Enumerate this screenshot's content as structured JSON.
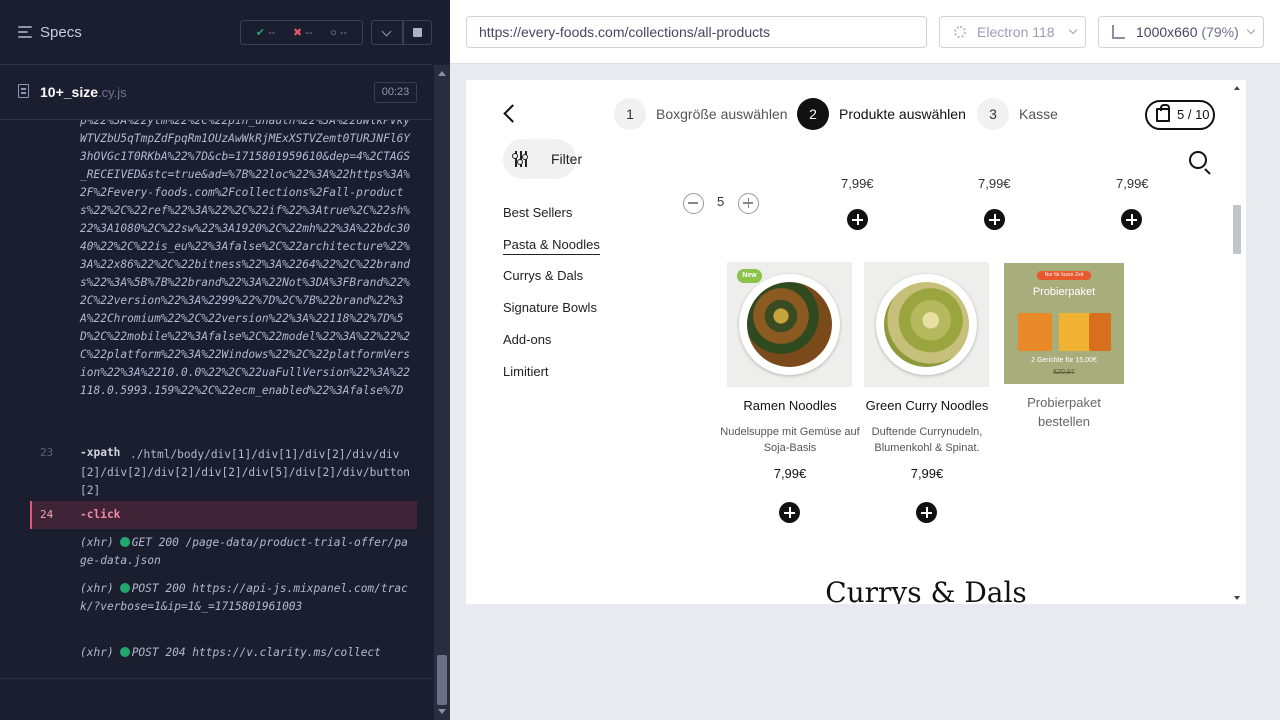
{
  "runner": {
    "specs_title": "Specs",
    "stats": {
      "passed": "--",
      "failed": "--",
      "pending": "--"
    },
    "file": {
      "name": "10+_size",
      "ext": ".cy.js",
      "duration": "00:23"
    },
    "log": {
      "url_text": "p%22%3A%22ytm%22%2C%22pin_unauth%22%3A%22dWlkPVkyWTVZbU5qTmpZdFpqRm1OUzAwWkRjMExXSTVZemt0TURJNFl6Y3hOVGc1T0RKbA%22%7D&cb=1715801959610&dep=4%2CTAGS_RECEIVED&stc=true&ad=%7B%22loc%22%3A%22https%3A%2F%2Fevery-foods.com%2Fcollections%2Fall-products%22%2C%22ref%22%3A%22%2C%22if%22%3Atrue%2C%22sh%22%3A1080%2C%22sw%22%3A1920%2C%22mh%22%3A%22bdc3040%22%2C%22is_eu%22%3Afalse%2C%22architecture%22%3A%22x86%22%2C%22bitness%22%3A%2264%22%2C%22brands%22%3A%5B%7B%22brand%22%3A%22Not%3DA%3FBrand%22%2C%22version%22%3A%2299%22%7D%2C%7B%22brand%22%3A%22Chromium%22%2C%22version%22%3A%22118%22%7D%5D%2C%22mobile%22%3Afalse%2C%22model%22%3A%22%22%2C%22platform%22%3A%22Windows%22%2C%22platformVersion%22%3A%2210.0.0%22%2C%22uaFullVersion%22%3A%22118.0.5993.159%22%2C%22ecm_enabled%22%3Afalse%7D",
      "cmd23": {
        "num": "23",
        "name": "-xpath",
        "msg": "./html/body/div[1]/div[1]/div[2]/div/div[2]/div[2]/div[2]/div[2]/div[5]/div[2]/div/button[2]"
      },
      "cmd24": {
        "num": "24",
        "name": "-click"
      },
      "xhr": [
        {
          "tag": "(xhr)",
          "text": "GET 200 /page-data/product-trial-offer/page-data.json"
        },
        {
          "tag": "(xhr)",
          "text": "POST 200 https://api-js.mixpanel.com/track/?verbose=1&ip=1&_=1715801961003"
        },
        {
          "tag": "(xhr)",
          "text": "POST 204 https://v.clarity.ms/collect"
        }
      ]
    }
  },
  "aut": {
    "url": "https://every-foods.com/collections/all-products",
    "browser": "Electron 118",
    "viewport": "1000x660",
    "zoom": "(79%)"
  },
  "page": {
    "steps": [
      {
        "num": "1",
        "label": "Boxgröße auswählen"
      },
      {
        "num": "2",
        "label": "Produkte auswählen"
      },
      {
        "num": "3",
        "label": "Kasse"
      }
    ],
    "cart": "5 / 10",
    "filter_label": "Filter",
    "categories": [
      "Best Sellers",
      "Pasta & Noodles",
      "Currys & Dals",
      "Signature Bowls",
      "Add-ons",
      "Limitiert"
    ],
    "cut_prices": [
      "7,99€",
      "7,99€",
      "7,99€"
    ],
    "quantity": "5",
    "products": [
      {
        "name": "Ramen Noodles",
        "desc": "Nudelsuppe mit Gemüse auf Soja-Basis",
        "price": "7,99€",
        "badge": "New"
      },
      {
        "name": "Green Curry Noodles",
        "desc": "Duftende Currynudeln, Blumenkohl & Spinat.",
        "price": "7,99€"
      }
    ],
    "trial": {
      "tag": "Nur für kurze Zeit",
      "title": "Probierpaket",
      "sub": "2 Gerichte für 15,00€",
      "old_price": "€20,97",
      "name": "Probierpaket bestellen"
    },
    "section_heading": "Currys & Dals"
  }
}
